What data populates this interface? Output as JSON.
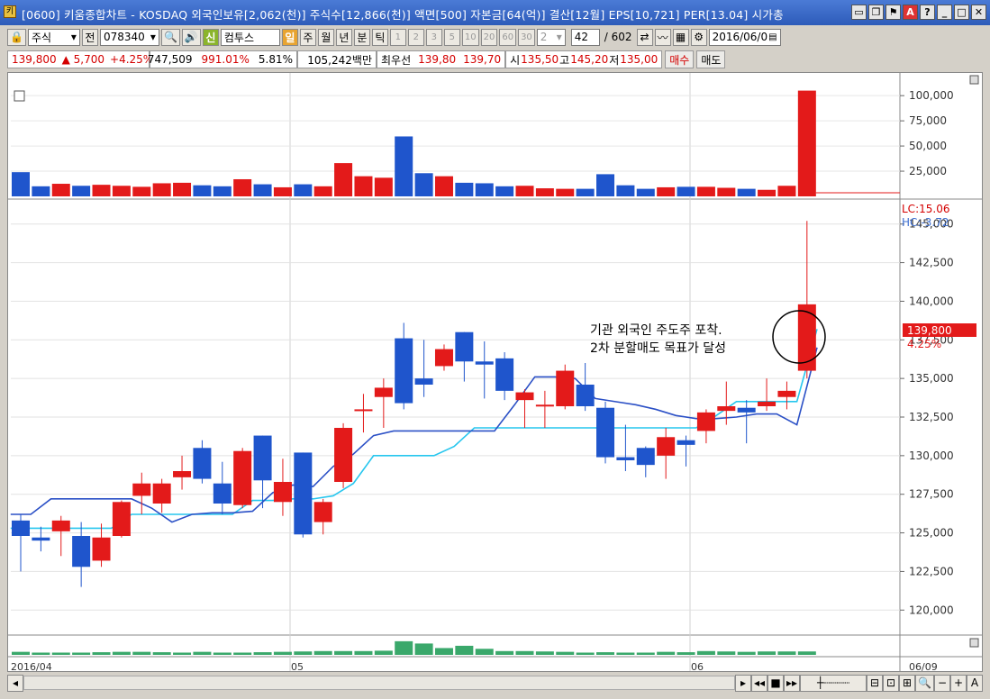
{
  "window": {
    "title": "[0600] 키움종합차트 - KOSDAQ 외국인보유[2,062(천)] 주식수[12,866(천)] 액면[500] 자본금[64(억)] 결산[12월] EPS[10,721] PER[13.04] 시가총",
    "icon_label": "키"
  },
  "toolbar": {
    "type_label": "주식",
    "code": "078340",
    "flag_label": "신",
    "name": "컴투스",
    "period_buttons": [
      "일",
      "주",
      "월",
      "년",
      "분",
      "틱"
    ],
    "interval_buttons": [
      "1",
      "2",
      "3",
      "5",
      "10",
      "20",
      "60",
      "30"
    ],
    "interval_value": "2",
    "count": "42",
    "total": "/ 602",
    "date": "2016/06/0"
  },
  "quote": {
    "price": "139,800",
    "change": "▲ 5,700",
    "change_pct": "+4.25%",
    "volume": "747,509",
    "vol_ratio": "991.01%",
    "turnover": "5.81%",
    "amount": "105,242백만",
    "best_label": "최우선",
    "best_ask": "139,80",
    "best_bid": "139,70",
    "open_label": "시",
    "open": "135,50",
    "high_label": "고",
    "high": "145,20",
    "low_label": "저",
    "low": "135,00",
    "buy_label": "매수",
    "sell_label": "매도"
  },
  "overlays": {
    "lc": "LC:15.06",
    "hc": "HC:-3.72",
    "last_price": "139,800",
    "last_pct": "4.25%"
  },
  "annotation": {
    "line1": "기관 외국인 주도주 포착.",
    "line2": "2차 분할매도 목표가 달성"
  },
  "axis": {
    "price_ticks": [
      "145,000",
      "142,500",
      "140,000",
      "137,500",
      "135,000",
      "132,500",
      "130,000",
      "127,500",
      "125,000",
      "122,500",
      "120,000"
    ],
    "volume_ticks": [
      "100,000",
      "75,000",
      "50,000",
      "25,000"
    ],
    "date_labels": [
      "2016/04",
      "05",
      "06"
    ],
    "corner_date": "06/09"
  },
  "colors": {
    "up": "#e31a1a",
    "down": "#1f55cc",
    "line_dark": "#2b50c6",
    "line_light": "#27c6ee",
    "osc": "#3aa86b"
  },
  "chart_data": {
    "type": "candlestick",
    "ylim": [
      118500,
      146500
    ],
    "candles": [
      {
        "o": 125800,
        "h": 126200,
        "l": 122500,
        "c": 124800
      },
      {
        "o": 124700,
        "h": 125400,
        "l": 123800,
        "c": 124500
      },
      {
        "o": 125100,
        "h": 126100,
        "l": 123500,
        "c": 125800
      },
      {
        "o": 124800,
        "h": 125700,
        "l": 121500,
        "c": 122800
      },
      {
        "o": 123200,
        "h": 125600,
        "l": 122800,
        "c": 124700
      },
      {
        "o": 124800,
        "h": 127100,
        "l": 124700,
        "c": 127000
      },
      {
        "o": 127400,
        "h": 128900,
        "l": 126200,
        "c": 128200
      },
      {
        "o": 126900,
        "h": 128500,
        "l": 126300,
        "c": 128200
      },
      {
        "o": 128600,
        "h": 130000,
        "l": 127800,
        "c": 129000
      },
      {
        "o": 130500,
        "h": 131000,
        "l": 128200,
        "c": 128500
      },
      {
        "o": 128200,
        "h": 129600,
        "l": 126200,
        "c": 126900
      },
      {
        "o": 126800,
        "h": 130500,
        "l": 126600,
        "c": 130300
      },
      {
        "o": 131300,
        "h": 131300,
        "l": 126600,
        "c": 128400
      },
      {
        "o": 127000,
        "h": 129800,
        "l": 126100,
        "c": 128300
      },
      {
        "o": 130200,
        "h": 130200,
        "l": 124700,
        "c": 124900
      },
      {
        "o": 125700,
        "h": 127200,
        "l": 124900,
        "c": 127000
      },
      {
        "o": 128300,
        "h": 132100,
        "l": 127900,
        "c": 131800
      },
      {
        "o": 133000,
        "h": 134000,
        "l": 131500,
        "c": 133000
      },
      {
        "o": 133800,
        "h": 135000,
        "l": 131800,
        "c": 134400
      },
      {
        "o": 137600,
        "h": 138600,
        "l": 133000,
        "c": 133400
      },
      {
        "o": 135000,
        "h": 137500,
        "l": 133800,
        "c": 134600
      },
      {
        "o": 135800,
        "h": 137200,
        "l": 135500,
        "c": 136900
      },
      {
        "o": 138000,
        "h": 138000,
        "l": 134800,
        "c": 136100
      },
      {
        "o": 136100,
        "h": 137400,
        "l": 133700,
        "c": 135900
      },
      {
        "o": 136300,
        "h": 136700,
        "l": 133600,
        "c": 134200
      },
      {
        "o": 133600,
        "h": 134300,
        "l": 131800,
        "c": 134100
      },
      {
        "o": 133300,
        "h": 134200,
        "l": 131800,
        "c": 133300
      },
      {
        "o": 133200,
        "h": 135900,
        "l": 133000,
        "c": 135500
      },
      {
        "o": 134600,
        "h": 136000,
        "l": 132900,
        "c": 133200
      },
      {
        "o": 133100,
        "h": 133500,
        "l": 129500,
        "c": 129900
      },
      {
        "o": 129900,
        "h": 132000,
        "l": 129000,
        "c": 129700
      },
      {
        "o": 130500,
        "h": 130600,
        "l": 128600,
        "c": 129400
      },
      {
        "o": 130000,
        "h": 131800,
        "l": 128500,
        "c": 131200
      },
      {
        "o": 131000,
        "h": 131300,
        "l": 129300,
        "c": 130700
      },
      {
        "o": 131600,
        "h": 133000,
        "l": 130800,
        "c": 132800
      },
      {
        "o": 132900,
        "h": 134800,
        "l": 132000,
        "c": 133200
      },
      {
        "o": 133100,
        "h": 133600,
        "l": 130800,
        "c": 132800
      },
      {
        "o": 133200,
        "h": 135000,
        "l": 132900,
        "c": 133500
      },
      {
        "o": 133800,
        "h": 134800,
        "l": 133000,
        "c": 134200
      },
      {
        "o": 135500,
        "h": 145200,
        "l": 135000,
        "c": 139800
      }
    ],
    "line_dark": [
      126200,
      126200,
      127200,
      127200,
      127200,
      127200,
      127200,
      126600,
      125700,
      126200,
      126300,
      126300,
      126400,
      127600,
      128100,
      128000,
      129300,
      130100,
      131300,
      131600,
      131600,
      131600,
      131600,
      131600,
      131600,
      133300,
      135100,
      135100,
      135000,
      133700,
      133500,
      133300,
      133000,
      132600,
      132400,
      132400,
      132500,
      132700,
      132700,
      132000,
      137000
    ],
    "line_light": [
      125300,
      125300,
      125300,
      125300,
      125300,
      125300,
      126200,
      126200,
      126200,
      126200,
      126200,
      126200,
      127100,
      127100,
      127200,
      127200,
      127400,
      128200,
      130000,
      130000,
      130000,
      130000,
      130600,
      131800,
      131800,
      131800,
      131800,
      131800,
      131800,
      131800,
      131800,
      131800,
      131800,
      131800,
      131800,
      132600,
      133500,
      133500,
      133500,
      133500,
      138200
    ],
    "volume": [
      24000,
      10000,
      12500,
      10500,
      11500,
      10500,
      9500,
      13000,
      13500,
      11000,
      10000,
      17000,
      12000,
      9000,
      12000,
      10000,
      33000,
      20000,
      18500,
      59500,
      23000,
      20000,
      13500,
      13000,
      10000,
      10500,
      8000,
      7500,
      7500,
      22000,
      11000,
      7500,
      9000,
      9500,
      9500,
      8500,
      7500,
      6500,
      10500,
      105000
    ],
    "volume_ylim": [
      0,
      110000
    ],
    "oscillator": [
      0.8,
      0.6,
      0.6,
      0.6,
      0.7,
      0.8,
      0.8,
      0.7,
      0.6,
      0.8,
      0.6,
      0.6,
      0.7,
      0.8,
      0.9,
      1.0,
      1.0,
      1.0,
      1.1,
      3.6,
      3.0,
      1.8,
      2.4,
      1.6,
      1.0,
      1.0,
      0.9,
      0.8,
      0.6,
      0.7,
      0.6,
      0.6,
      0.8,
      0.7,
      1.0,
      0.9,
      0.8,
      0.9,
      0.9,
      0.9
    ]
  }
}
